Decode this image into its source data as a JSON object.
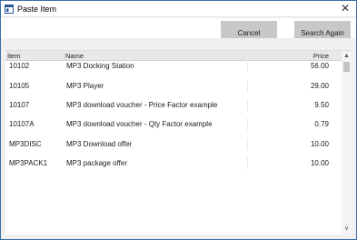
{
  "window": {
    "title": "Paste Item",
    "close_glyph": "✕"
  },
  "buttons": {
    "cancel": "Cancel",
    "search_again": "Search Again"
  },
  "grid": {
    "columns": {
      "item": "Item",
      "name": "Name",
      "price": "Price"
    },
    "rows": [
      {
        "item": "10102",
        "name": "MP3 Docking Station",
        "price": "56.00"
      },
      {
        "item": "10105",
        "name": "MP3 Player",
        "price": "29.00"
      },
      {
        "item": "10107",
        "name": "MP3 download voucher - Price Factor example",
        "price": "9.50"
      },
      {
        "item": "10107A",
        "name": "MP3 download voucher - Qty Factor example",
        "price": "0.79"
      },
      {
        "item": "MP3DISC",
        "name": "MP3 Download offer",
        "price": "10.00"
      },
      {
        "item": "MP3PACK1",
        "name": "MP3 package offer",
        "price": "10.00"
      }
    ]
  },
  "scrollbar": {
    "up_glyph": "▲",
    "down_glyph": "∨"
  },
  "colors": {
    "button_bg": "#c8c8c8",
    "header_bg": "#e8e8e8",
    "border": "#3b6ea5"
  }
}
